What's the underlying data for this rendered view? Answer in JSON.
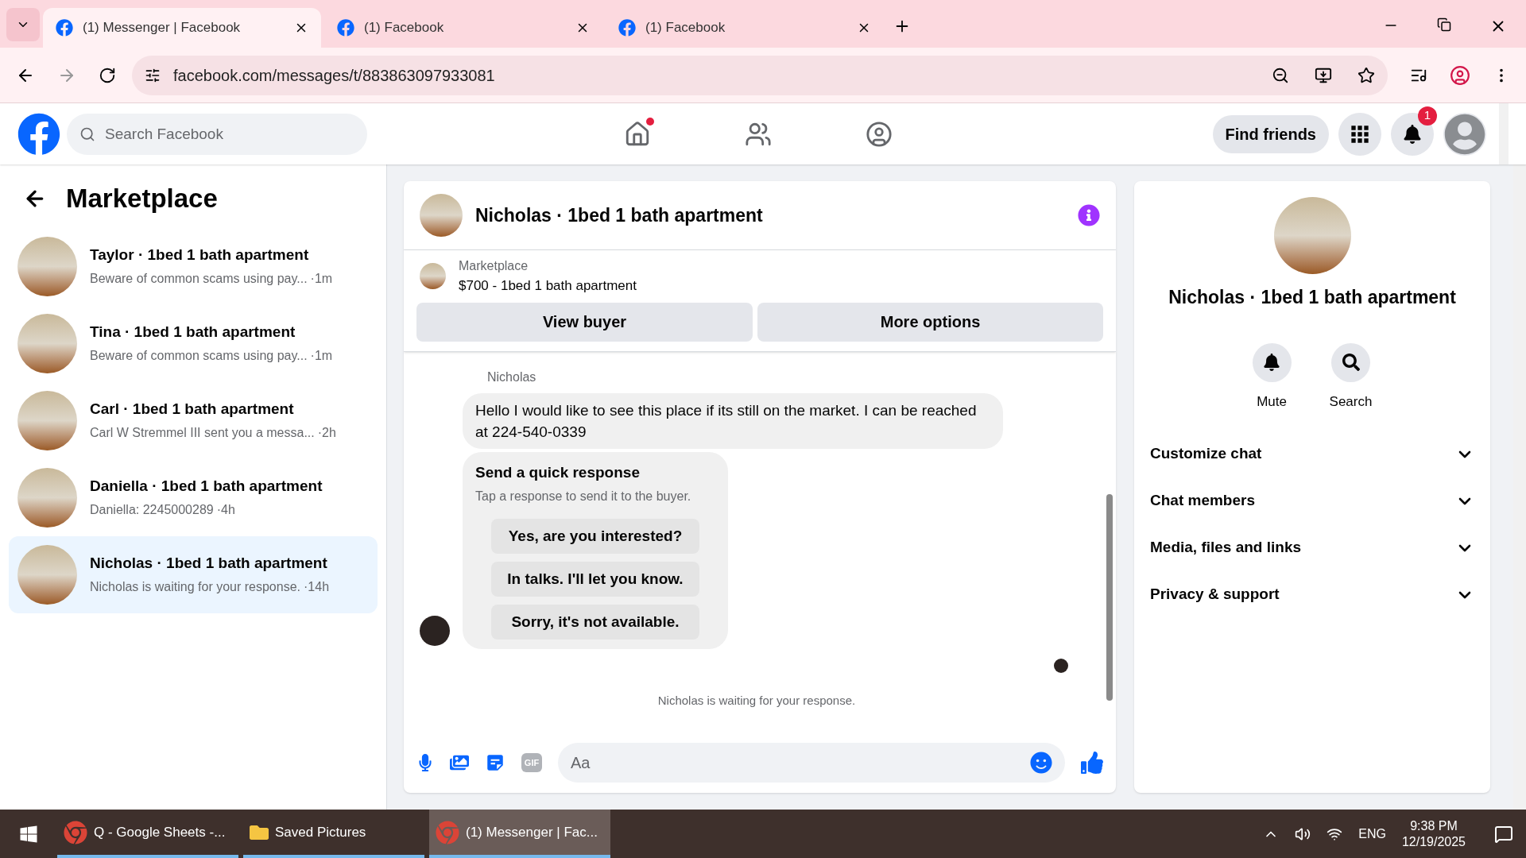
{
  "browser": {
    "tabs": [
      {
        "title": "(1) Messenger | Facebook",
        "selected": true
      },
      {
        "title": "(1) Facebook",
        "selected": false
      },
      {
        "title": "(1) Facebook",
        "selected": false
      }
    ],
    "address": "facebook.com/messages/t/883863097933081"
  },
  "topbar": {
    "search_placeholder": "Search Facebook",
    "find_friends": "Find friends",
    "notification_count": "1"
  },
  "sidebar": {
    "title": "Marketplace",
    "conversations": [
      {
        "name": "Taylor · 1bed 1 bath apartment",
        "preview": "Beware of common scams using pay...",
        "time": "·1m",
        "selected": false
      },
      {
        "name": "Tina · 1bed 1 bath apartment",
        "preview": "Beware of common scams using pay...",
        "time": "·1m",
        "selected": false
      },
      {
        "name": "Carl · 1bed 1 bath apartment",
        "preview": "Carl W Stremmel III sent you a messa...",
        "time": "·2h",
        "selected": false
      },
      {
        "name": "Daniella · 1bed 1 bath apartment",
        "preview": "Daniella: 2245000289",
        "time": "·4h",
        "selected": false
      },
      {
        "name": "Nicholas · 1bed 1 bath apartment",
        "preview": "Nicholas is waiting for your response.",
        "time": "·14h",
        "selected": true
      }
    ]
  },
  "chat": {
    "title": "Nicholas · 1bed 1 bath apartment",
    "listing": {
      "label": "Marketplace",
      "title": "$700 - 1bed 1 bath apartment"
    },
    "buttons": [
      "View buyer",
      "More options"
    ],
    "sender": "Nicholas",
    "message": "Hello I would like to see this place if its still on the market. I can be reached at 224-540-0339",
    "quick_response": {
      "title": "Send a quick response",
      "subtitle": "Tap a response to send it to the buyer.",
      "options": [
        "Yes, are you interested?",
        "In talks. I'll let you know.",
        "Sorry, it's not available."
      ]
    },
    "status": "Nicholas is waiting for your response.",
    "composer_placeholder": "Aa",
    "gif_label": "GIF"
  },
  "details": {
    "title": "Nicholas · 1bed 1 bath apartment",
    "actions": [
      {
        "kind": "mute",
        "label": "Mute"
      },
      {
        "kind": "search",
        "label": "Search"
      }
    ],
    "sections": [
      "Customize chat",
      "Chat members",
      "Media, files and links",
      "Privacy & support"
    ]
  },
  "taskbar": {
    "apps": [
      {
        "kind": "chrome",
        "label": "Q - Google Sheets -...",
        "selected": false
      },
      {
        "kind": "folder",
        "label": "Saved Pictures",
        "selected": false
      },
      {
        "kind": "chrome",
        "label": "(1) Messenger | Fac...",
        "selected": true
      }
    ],
    "language": "ENG",
    "time": "9:38 PM",
    "date": "12/19/2025"
  }
}
